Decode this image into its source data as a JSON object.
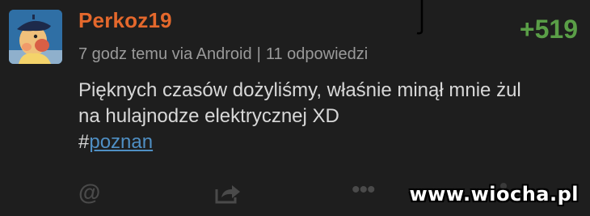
{
  "post": {
    "author": "Perkoz19",
    "time": "7 godz temu",
    "via": "via Android",
    "separator": "|",
    "replies": "11 odpowiedzi",
    "score": "+519",
    "text_line1": "Pięknych czasów dożyliśmy, właśnie minął mnie żul",
    "text_line2": "na hulajnodze elektrycznej XD",
    "hash": "#",
    "tag": "poznan"
  },
  "actions": {
    "mention": "@",
    "more": "•••"
  },
  "watermark": "www.wiocha.pl",
  "colors": {
    "background": "#1e1e1e",
    "author": "#e4682c",
    "score": "#5a9e47",
    "tag": "#4f8fc4",
    "meta": "#9a9a9a",
    "text": "#d8d8d8",
    "icons": "#4a4a4a"
  },
  "icons": [
    "avatar-cartoon",
    "at-sign-icon",
    "share-icon",
    "more-dots-icon"
  ]
}
